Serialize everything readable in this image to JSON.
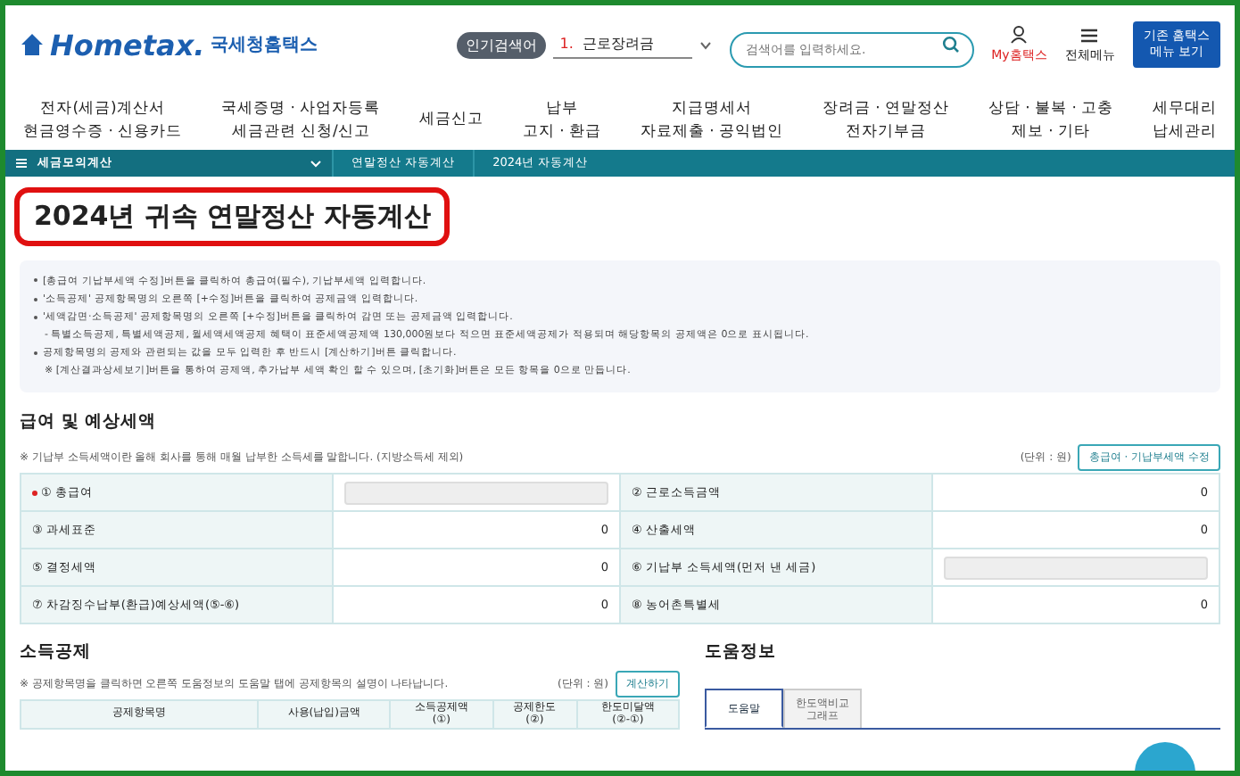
{
  "header": {
    "logo_text": "Hometax.",
    "site_name": "국세청홈택스",
    "popular": {
      "badge": "인기검색어",
      "rank": "1.",
      "term": "근로장려금"
    },
    "search": {
      "placeholder": "검색어를 입력하세요."
    },
    "my_link": "My홈택스",
    "menu_link": "전체메뉴",
    "legacy_button": [
      "기존 홈택스",
      "메뉴 보기"
    ]
  },
  "nav": [
    {
      "lines": [
        "전자(세금)계산서",
        "현금영수증 · 신용카드"
      ]
    },
    {
      "lines": [
        "국세증명 · 사업자등록",
        "세금관련 신청/신고"
      ]
    },
    {
      "lines": [
        "세금신고"
      ]
    },
    {
      "lines": [
        "납부",
        "고지 · 환급"
      ]
    },
    {
      "lines": [
        "지급명세서",
        "자료제출 · 공익법인"
      ]
    },
    {
      "lines": [
        "장려금 · 연말정산",
        "전자기부금"
      ]
    },
    {
      "lines": [
        "상담 · 불복 · 고충",
        "제보 · 기타"
      ]
    },
    {
      "lines": [
        "세무대리",
        "납세관리"
      ]
    }
  ],
  "breadcrumb": {
    "menu": "세금모의계산",
    "items": [
      "연말정산 자동계산",
      "2024년 자동계산"
    ]
  },
  "title": "2024년 귀속 연말정산 자동계산",
  "notes": [
    {
      "kind": "bullet",
      "text": "[총급여 기납부세액 수정]버튼을 클릭하여 총급여(필수), 기납부세액 입력합니다."
    },
    {
      "kind": "bullet",
      "text": "'소득공제' 공제항목명의 오른쪽 [+수정]버튼을 클릭하여 공제금액 입력합니다."
    },
    {
      "kind": "bullet",
      "text": "'세액감면·소득공제' 공제항목명의 오른쪽 [+수정]버튼을 클릭하여 감면 또는 공제금액 입력합니다."
    },
    {
      "kind": "sub",
      "text": "- 특별소득공제, 특별세액공제, 월세액세액공제 혜택이 표준세액공제액 130,000원보다 적으면 표준세액공제가 적용되며 해당항목의 공제액은 0으로 표시됩니다."
    },
    {
      "kind": "bullet",
      "text": "공제항목명의 공제와 관련되는 값을 모두 입력한 후 반드시 [계산하기]버튼 클릭합니다."
    },
    {
      "kind": "remark",
      "text": "※ [계산결과상세보기]버튼을 통하여 공제액, 추가납부 세액 확인 할 수 있으며, [초기화]버튼은 모든 항목을 0으로 만듭니다."
    }
  ],
  "salary": {
    "heading": "급여 및 예상세액",
    "note": "※ 기납부 소득세액이란 올해 회사를 통해 매월 납부한 소득세를 말합니다. (지방소득세 제외)",
    "unit": "(단위 : 원)",
    "button": "총급여 · 기납부세액 수정",
    "rows": [
      [
        {
          "label": "① 총급여",
          "required": true,
          "kind": "input"
        },
        {
          "label": "② 근로소득금액",
          "required": false,
          "kind": "value",
          "value": "0"
        }
      ],
      [
        {
          "label": "③ 과세표준",
          "required": false,
          "kind": "value",
          "value": "0"
        },
        {
          "label": "④ 산출세액",
          "required": false,
          "kind": "value",
          "value": "0"
        }
      ],
      [
        {
          "label": "⑤ 결정세액",
          "required": false,
          "kind": "value",
          "value": "0"
        },
        {
          "label": "⑥ 기납부 소득세액(먼저 낸 세금)",
          "required": false,
          "kind": "input"
        }
      ],
      [
        {
          "label": "⑦ 차감징수납부(환급)예상세액(⑤-⑥)",
          "required": false,
          "kind": "value",
          "value": "0"
        },
        {
          "label": "⑧ 농어촌특별세",
          "required": false,
          "kind": "value",
          "value": "0"
        }
      ]
    ]
  },
  "deduction": {
    "heading": "소득공제",
    "note": "※ 공제항목명을 클릭하면 오른쪽 도움정보의 도움말 탭에 공제항목의 설명이 나타납니다.",
    "unit": "(단위 : 원)",
    "button": "계산하기",
    "columns": [
      [
        "공제항목명"
      ],
      [
        "사용(납입)금액"
      ],
      [
        "소득공제액",
        "(①)"
      ],
      [
        "공제한도",
        "(②)"
      ],
      [
        "한도미달액",
        "(②-①)"
      ]
    ]
  },
  "help": {
    "heading": "도움정보",
    "tabs": [
      {
        "lines": [
          "도움말"
        ],
        "selected": true
      },
      {
        "lines": [
          "한도액비교",
          "그래프"
        ],
        "selected": false
      }
    ]
  }
}
